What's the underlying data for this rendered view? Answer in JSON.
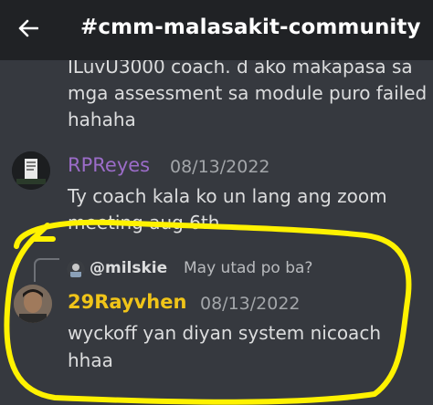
{
  "header": {
    "title": "#cmm-malasakit-community"
  },
  "messages": [
    {
      "lines": [
        "ILuvU3000 coach. d ako makapasa sa",
        "mga assessment sa module puro failed",
        "hahaha"
      ]
    },
    {
      "username": "RPReyes",
      "timestamp": "08/13/2022",
      "lines": [
        "Ty coach kala ko un lang ang zoom",
        "meeting aug 6th"
      ]
    },
    {
      "reply": {
        "user": "@milskie",
        "text": "May utad po ba?"
      },
      "username": "29Rayvhen",
      "timestamp": "08/13/2022",
      "lines": [
        "wyckoff yan diyan system nicoach",
        "hhaa"
      ]
    }
  ],
  "colors": {
    "background": "#36393f",
    "header_bg": "#202225",
    "username_rpreyes": "#9b6cc8",
    "username_rayvhen": "#f0c419",
    "highlight": "#fff200"
  },
  "icons": [
    "back-arrow-icon"
  ]
}
